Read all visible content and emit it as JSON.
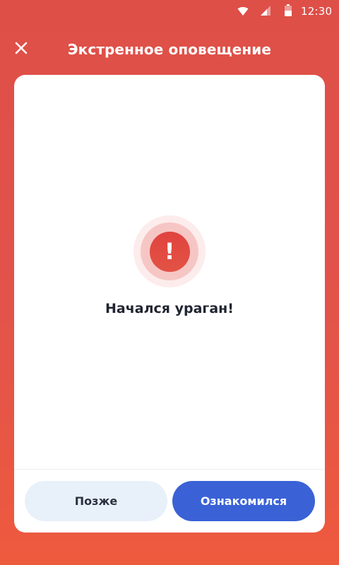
{
  "status_bar": {
    "time": "12:30",
    "icons": [
      "wifi-icon",
      "signal-icon",
      "battery-icon"
    ]
  },
  "app_bar": {
    "title": "Экстренное оповещение",
    "close_icon": "close-icon"
  },
  "alert": {
    "icon": "exclamation-alert-icon",
    "icon_glyph": "!",
    "message": "Начался ураган!"
  },
  "actions": {
    "later_label": "Позже",
    "acknowledge_label": "Ознакомился"
  },
  "colors": {
    "background": "#E2534A",
    "accent_button": "#3A62D6",
    "secondary_button": "#E8F1FA",
    "alert_red": "#E0443E"
  }
}
